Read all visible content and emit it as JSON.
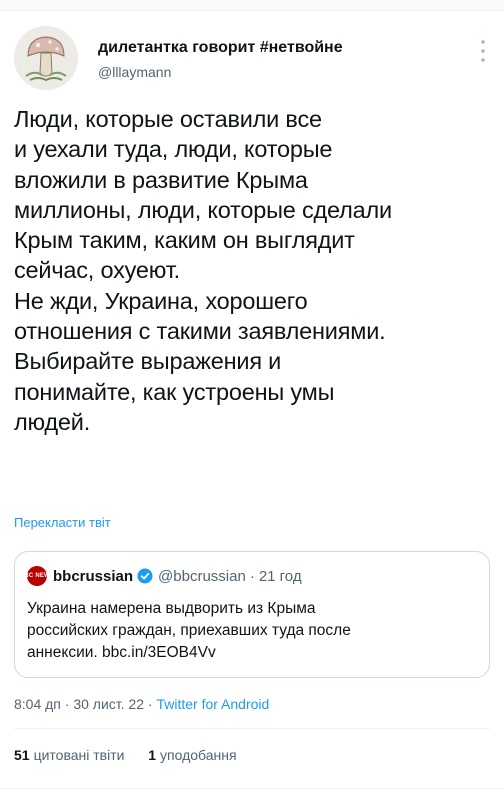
{
  "author": {
    "display_name": "дилетантка говорит #нетвойне",
    "handle": "@lllaymann",
    "avatar_icon": "mushroom-avatar"
  },
  "tweet": {
    "text": "Люди, которые оставили все\nи уехали туда, люди, которые\nвложили в развитие Крыма\nмиллионы, люди, которые сделали\nКрым таким, каким он выглядит\nсейчас, охуеют.\nНе жди, Украина, хорошего\nотношения с такими заявлениями.\nВыбирайте выражения и\nпонимайте, как устроены умы\nлюдей.",
    "translate_label": "Перекласти твіт"
  },
  "quote": {
    "logo_text": "BBC NEWS",
    "name": "bbcrussian",
    "verified_icon": "verified-badge-icon",
    "handle": "@bbcrussian",
    "dot": "·",
    "time": "21 год",
    "text": "Украина намерена выдворить из Крыма\nроссийских граждан, приехавших туда после\nаннексии. bbc.in/3EOB4Vv"
  },
  "meta": {
    "time": "8:04 дп",
    "date": "30 лист. 22",
    "separator": "·",
    "source": "Twitter for Android"
  },
  "stats": {
    "quotes_count": "51",
    "quotes_label": "цитовані твіти",
    "likes_count": "1",
    "likes_label": "уподобання"
  },
  "colors": {
    "accent": "#1d9bf0",
    "text": "#0f1419",
    "secondary": "#536471",
    "bbc_red": "#b80000"
  }
}
